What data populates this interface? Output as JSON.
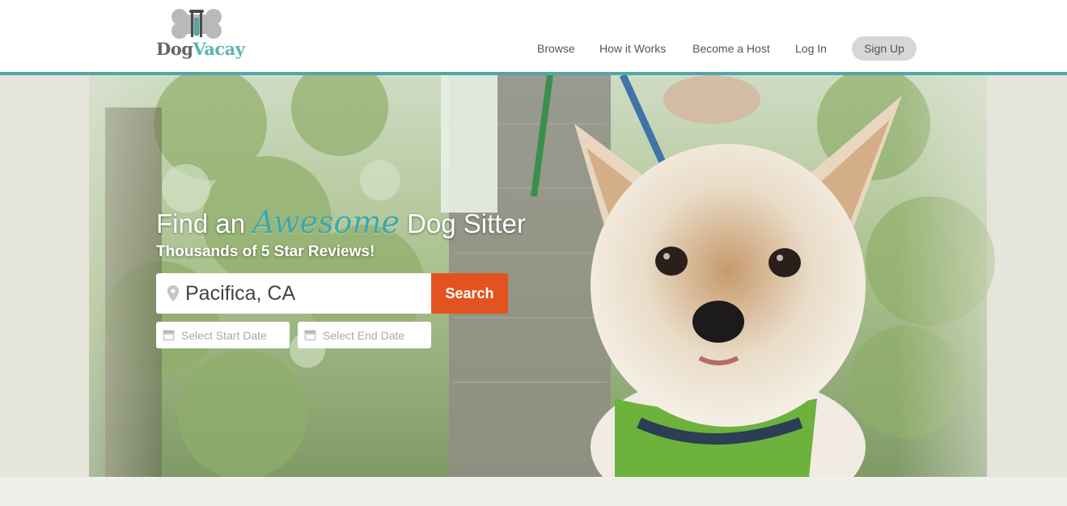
{
  "brand": {
    "logo_dog": "Dog",
    "logo_vacay": "Vacay",
    "teal": "#4fa7a6",
    "accent_orange": "#e35320"
  },
  "nav": {
    "browse": "Browse",
    "how_it_works": "How it Works",
    "become_host": "Become a Host",
    "log_in": "Log In",
    "sign_up": "Sign Up"
  },
  "hero": {
    "title_before": "Find an",
    "title_awesome": "Awesome",
    "title_after": "Dog Sitter",
    "subtitle": "Thousands of 5 Star Reviews!",
    "photo_subject": "yorkshire-terrier-on-leash"
  },
  "search": {
    "location_value": "Pacifica, CA",
    "location_icon": "map-pin-icon",
    "button_label": "Search",
    "start_date_placeholder": "Select Start Date",
    "end_date_placeholder": "Select End Date",
    "date_icon": "calendar-icon"
  }
}
